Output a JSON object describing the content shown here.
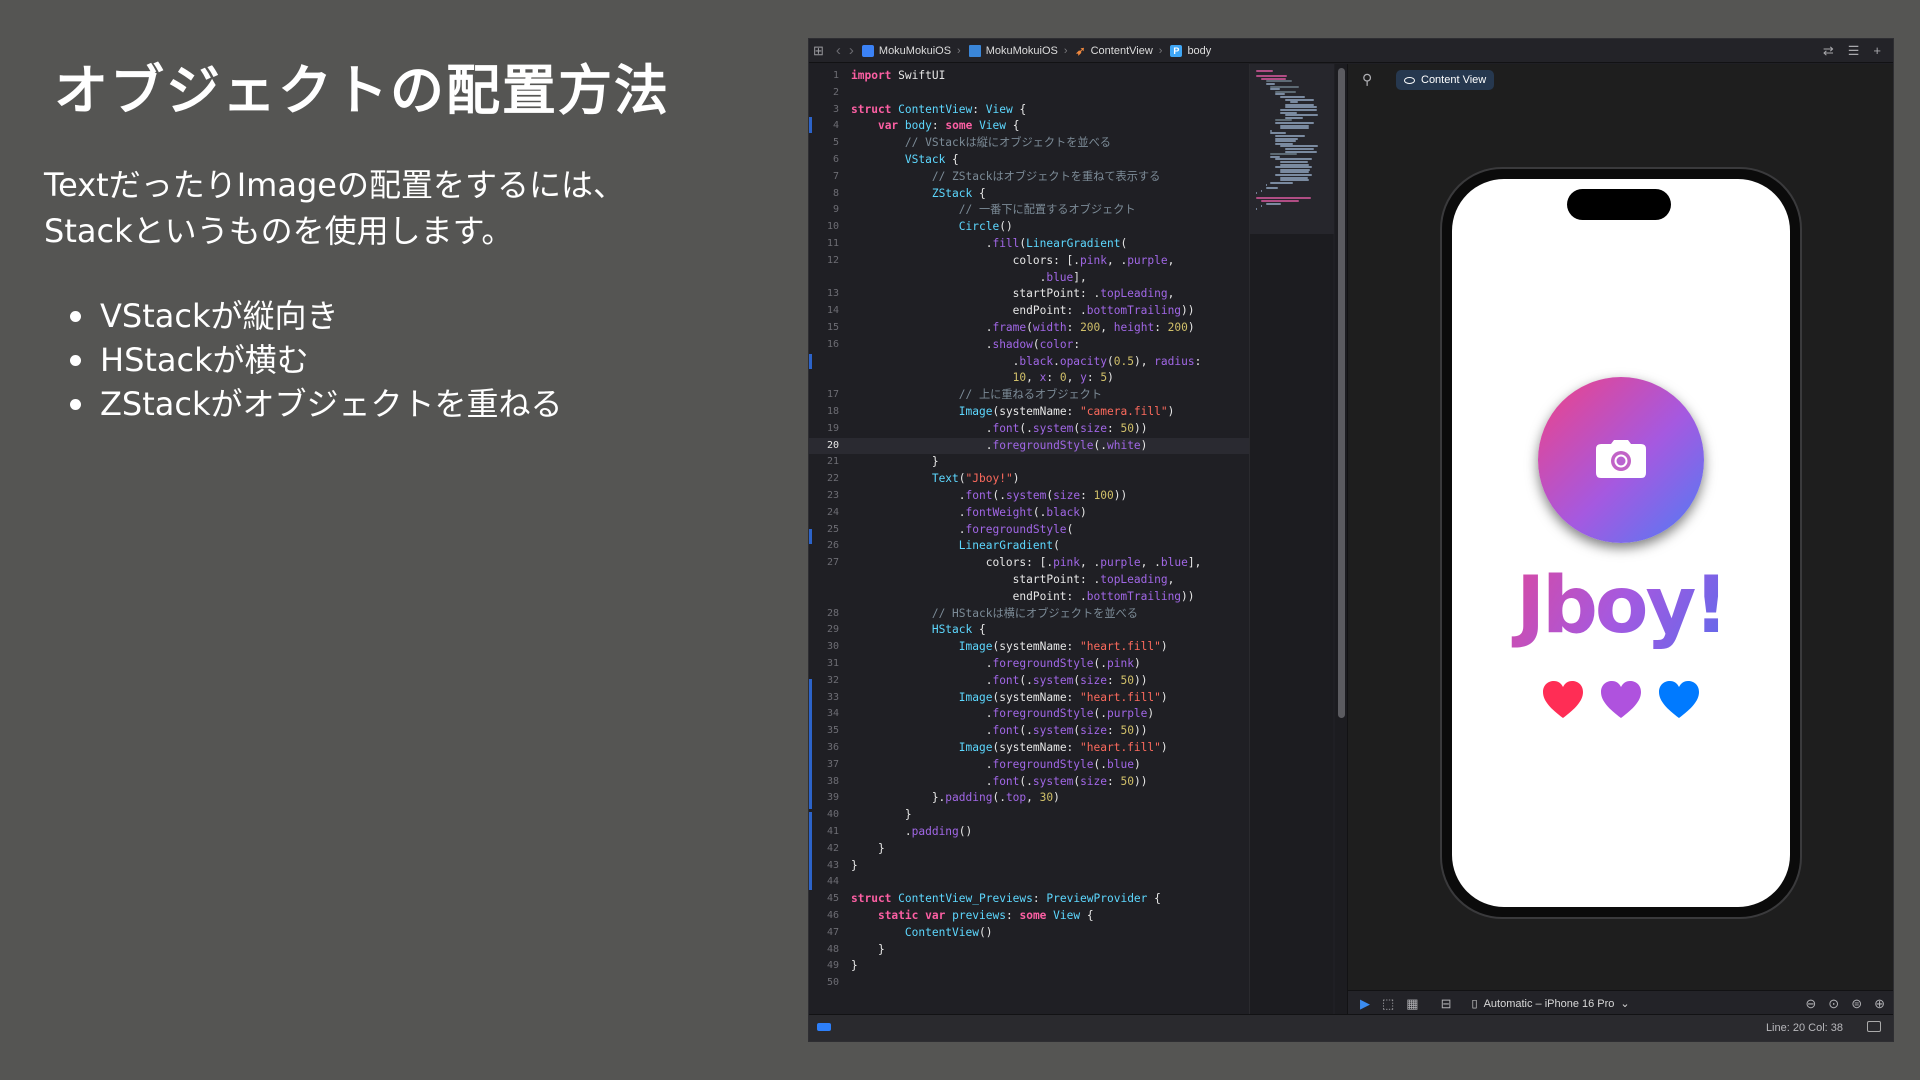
{
  "slide": {
    "title": "オブジェクトの配置方法",
    "desc_line1": "TextだったりImageの配置をするには、",
    "desc_line2": "Stackというものを使用します。",
    "bullets": [
      "VStackが縦向き",
      "HStackが横む",
      "ZStackがオブジェクトを重ねる"
    ]
  },
  "jumpbar": {
    "crumbs": [
      "MokuMokuiOS",
      "MokuMokuiOS",
      "ContentView",
      "body"
    ]
  },
  "editor": {
    "current_line": 20,
    "lines": [
      {
        "n": "1",
        "code": "<span class=\"kw\">import</span> SwiftUI"
      },
      {
        "n": "2",
        "code": ""
      },
      {
        "n": "3",
        "code": "<span class=\"kw\">struct</span> <span class=\"ty\">ContentView</span>: <span class=\"ty\">View</span> {"
      },
      {
        "n": "4",
        "code": "    <span class=\"kw\">var</span> <span class=\"ty\">body</span>: <span class=\"kw\">some</span> <span class=\"ty\">View</span> {"
      },
      {
        "n": "5",
        "code": "        <span class=\"cm\">// VStackは縦にオブジェクトを並べる</span>"
      },
      {
        "n": "6",
        "code": "        <span class=\"ty\">VStack</span> {"
      },
      {
        "n": "7",
        "code": "            <span class=\"cm\">// ZStackはオブジェクトを重ねて表示する</span>"
      },
      {
        "n": "8",
        "code": "            <span class=\"ty\">ZStack</span> {"
      },
      {
        "n": "9",
        "code": "                <span class=\"cm\">// 一番下に配置するオブジェクト</span>"
      },
      {
        "n": "10",
        "code": "                <span class=\"ty\">Circle</span>()"
      },
      {
        "n": "11",
        "code": "                    .<span class=\"fn\">fill</span>(<span class=\"ty\">LinearGradient</span>("
      },
      {
        "n": "12",
        "code": "                        colors: [.<span class=\"pr\">pink</span>, .<span class=\"pr\">purple</span>,"
      },
      {
        "n": "",
        "code": "                            .<span class=\"pr\">blue</span>],"
      },
      {
        "n": "13",
        "code": "                        startPoint: .<span class=\"pr\">topLeading</span>,"
      },
      {
        "n": "14",
        "code": "                        endPoint: .<span class=\"pr\">bottomTrailing</span>))"
      },
      {
        "n": "15",
        "code": "                    .<span class=\"fn\">frame</span>(<span class=\"fn\">width</span>: <span class=\"num\">200</span>, <span class=\"fn\">height</span>: <span class=\"num\">200</span>)"
      },
      {
        "n": "16",
        "code": "                    .<span class=\"fn\">shadow</span>(<span class=\"fn\">color</span>:"
      },
      {
        "n": "",
        "code": "                        .<span class=\"pr\">black</span>.<span class=\"fn\">opacity</span>(<span class=\"num\">0.5</span>), <span class=\"fn\">radius</span>:"
      },
      {
        "n": "",
        "code": "                        <span class=\"num\">10</span>, <span class=\"fn\">x</span>: <span class=\"num\">0</span>, <span class=\"fn\">y</span>: <span class=\"num\">5</span>)"
      },
      {
        "n": "17",
        "code": "                <span class=\"cm\">// 上に重ねるオブジェクト</span>"
      },
      {
        "n": "18",
        "code": "                <span class=\"ty\">Image</span>(systemName: <span class=\"str\">\"camera.fill\"</span>)"
      },
      {
        "n": "19",
        "code": "                    .<span class=\"fn\">font</span>(.<span class=\"fn\">system</span>(<span class=\"fn\">size</span>: <span class=\"num\">50</span>))"
      },
      {
        "n": "20",
        "code": "                    .<span class=\"fn\">foregroundStyle</span>(.<span class=\"pr\">white</span>)"
      },
      {
        "n": "21",
        "code": "            }"
      },
      {
        "n": "22",
        "code": "            <span class=\"ty\">Text</span>(<span class=\"str\">\"Jboy!\"</span>)"
      },
      {
        "n": "23",
        "code": "                .<span class=\"fn\">font</span>(.<span class=\"fn\">system</span>(<span class=\"fn\">size</span>: <span class=\"num\">100</span>))"
      },
      {
        "n": "24",
        "code": "                .<span class=\"fn\">fontWeight</span>(.<span class=\"pr\">black</span>)"
      },
      {
        "n": "25",
        "code": "                .<span class=\"fn\">foregroundStyle</span>("
      },
      {
        "n": "26",
        "code": "                <span class=\"ty\">LinearGradient</span>("
      },
      {
        "n": "27",
        "code": "                    colors: [.<span class=\"pr\">pink</span>, .<span class=\"pr\">purple</span>, .<span class=\"pr\">blue</span>],"
      },
      {
        "n": "",
        "code": "                        startPoint: .<span class=\"pr\">topLeading</span>,"
      },
      {
        "n": "",
        "code": "                        endPoint: .<span class=\"pr\">bottomTrailing</span>))"
      },
      {
        "n": "28",
        "code": "            <span class=\"cm\">// HStackは横にオブジェクトを並べる</span>"
      },
      {
        "n": "29",
        "code": "            <span class=\"ty\">HStack</span> {"
      },
      {
        "n": "30",
        "code": "                <span class=\"ty\">Image</span>(systemName: <span class=\"str\">\"heart.fill\"</span>)"
      },
      {
        "n": "31",
        "code": "                    .<span class=\"fn\">foregroundStyle</span>(.<span class=\"pr\">pink</span>)"
      },
      {
        "n": "32",
        "code": "                    .<span class=\"fn\">font</span>(.<span class=\"fn\">system</span>(<span class=\"fn\">size</span>: <span class=\"num\">50</span>))"
      },
      {
        "n": "33",
        "code": "                <span class=\"ty\">Image</span>(systemName: <span class=\"str\">\"heart.fill\"</span>)"
      },
      {
        "n": "34",
        "code": "                    .<span class=\"fn\">foregroundStyle</span>(.<span class=\"pr\">purple</span>)"
      },
      {
        "n": "35",
        "code": "                    .<span class=\"fn\">font</span>(.<span class=\"fn\">system</span>(<span class=\"fn\">size</span>: <span class=\"num\">50</span>))"
      },
      {
        "n": "36",
        "code": "                <span class=\"ty\">Image</span>(systemName: <span class=\"str\">\"heart.fill\"</span>)"
      },
      {
        "n": "37",
        "code": "                    .<span class=\"fn\">foregroundStyle</span>(.<span class=\"pr\">blue</span>)"
      },
      {
        "n": "38",
        "code": "                    .<span class=\"fn\">font</span>(.<span class=\"fn\">system</span>(<span class=\"fn\">size</span>: <span class=\"num\">50</span>))"
      },
      {
        "n": "39",
        "code": "            }.<span class=\"fn\">padding</span>(.<span class=\"pr\">top</span>, <span class=\"num\">30</span>)"
      },
      {
        "n": "40",
        "code": "        }"
      },
      {
        "n": "41",
        "code": "        .<span class=\"fn\">padding</span>()"
      },
      {
        "n": "42",
        "code": "    }"
      },
      {
        "n": "43",
        "code": "}"
      },
      {
        "n": "44",
        "code": ""
      },
      {
        "n": "45",
        "code": "<span class=\"kw\">struct</span> <span class=\"ty\">ContentView_Previews</span>: <span class=\"ty\">PreviewProvider</span> {"
      },
      {
        "n": "46",
        "code": "    <span class=\"kw\">static</span> <span class=\"kw\">var</span> <span class=\"ty\">previews</span>: <span class=\"kw\">some</span> <span class=\"ty\">View</span> {"
      },
      {
        "n": "47",
        "code": "        <span class=\"ty\">ContentView</span>()"
      },
      {
        "n": "48",
        "code": "    }"
      },
      {
        "n": "49",
        "code": "}"
      },
      {
        "n": "50",
        "code": ""
      }
    ]
  },
  "canvas": {
    "preview_label": "Content View",
    "app_text": "Jboy!",
    "device": "Automatic – iPhone 16 Pro",
    "heart_colors": [
      "#ff2d55",
      "#af52de",
      "#007aff"
    ]
  },
  "status": {
    "position": "Line: 20  Col: 38"
  }
}
